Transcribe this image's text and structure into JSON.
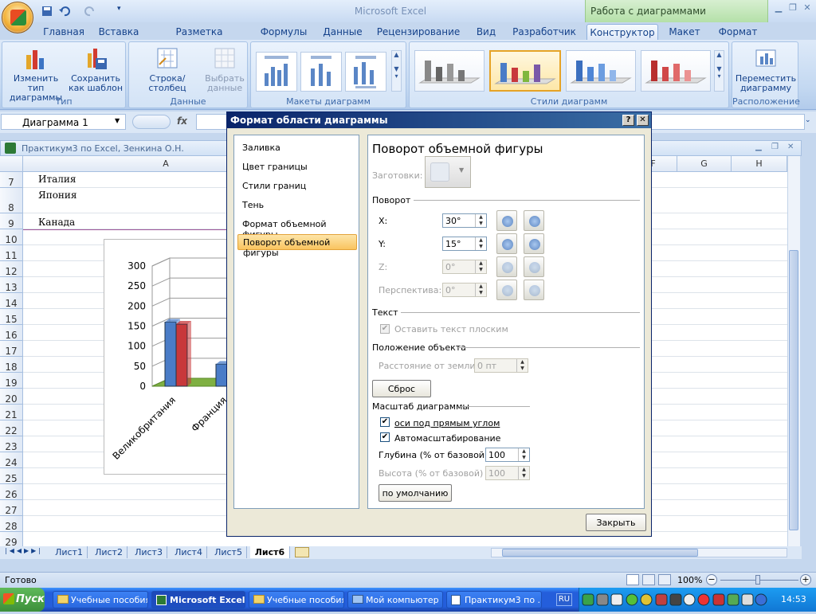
{
  "app": {
    "title": "Microsoft Excel",
    "context_tab_group": "Работа с диаграммами"
  },
  "ribbon": {
    "tabs": [
      "Главная",
      "Вставка",
      "Разметка страницы",
      "Формулы",
      "Данные",
      "Рецензирование",
      "Вид",
      "Разработчик",
      "Конструктор",
      "Макет",
      "Формат"
    ],
    "active_tab": "Конструктор",
    "groups": {
      "type": {
        "label": "Тип",
        "change_type": "Изменить тип диаграммы",
        "save_template": "Сохранить как шаблон"
      },
      "data": {
        "label": "Данные",
        "switch_row_col": "Строка/столбец",
        "select_data": "Выбрать данные"
      },
      "layouts": {
        "label": "Макеты диаграмм"
      },
      "styles": {
        "label": "Стили диаграмм"
      },
      "location": {
        "label": "Расположение",
        "move_chart": "Переместить диаграмму"
      }
    }
  },
  "formula_bar": {
    "name_box": "Диаграмма 1",
    "fx": "fx",
    "value": ""
  },
  "workbook": {
    "title": "Практикум3 по Excel, Зенкина О.Н.",
    "columns": [
      "A",
      "F",
      "G",
      "H"
    ],
    "rows": [
      "7",
      "8",
      "9",
      "10",
      "11",
      "12",
      "13",
      "14",
      "15",
      "16",
      "17",
      "18",
      "19",
      "20",
      "21",
      "22",
      "23",
      "24",
      "25",
      "26",
      "27",
      "28",
      "29"
    ],
    "cells": {
      "r7": "Италия",
      "r8": "Япония",
      "r9": "Канада"
    }
  },
  "chart_data": {
    "type": "bar",
    "categories": [
      "Великобритания",
      "Франция"
    ],
    "series": [
      {
        "values": [
          160,
          55
        ]
      },
      {
        "values": [
          155,
          50
        ]
      }
    ],
    "ylim": [
      0,
      300
    ],
    "yticks": [
      "300",
      "250",
      "200",
      "150",
      "100",
      "50",
      "0"
    ],
    "colors": [
      "#4a7cc7",
      "#c8383b"
    ]
  },
  "sheets": {
    "tabs": [
      "Лист1",
      "Лист2",
      "Лист3",
      "Лист4",
      "Лист5",
      "Лист6"
    ],
    "active": "Лист6"
  },
  "status": {
    "ready": "Готово",
    "zoom": "100%"
  },
  "dialog": {
    "title": "Формат области диаграммы",
    "help": "?",
    "close_x": "✕",
    "nav": [
      "Заливка",
      "Цвет границы",
      "Стили границ",
      "Тень",
      "Формат объемной фигуры",
      "Поворот объемной фигуры"
    ],
    "nav_selected": "Поворот объемной фигуры",
    "heading": "Поворот объемной фигуры",
    "presets_label": "Заготовки:",
    "rotation_section": "Поворот",
    "x_label": "X:",
    "x_value": "30°",
    "y_label": "Y:",
    "y_value": "15°",
    "z_label": "Z:",
    "z_value": "0°",
    "persp_label": "Перспектива:",
    "persp_value": "0°",
    "text_section": "Текст",
    "keep_flat": "Оставить текст плоским",
    "position_section": "Положение объекта",
    "distance_label": "Расстояние от земли:",
    "distance_value": "0 пт",
    "reset": "Сброс",
    "scale_section": "Масштаб диаграммы",
    "right_angle": "оси под прямым углом",
    "autoscale": "Автомасштабирование",
    "depth_label": "Глубина (% от базовой)",
    "depth_value": "100",
    "height_label": "Высота (% от базовой)",
    "height_value": "100",
    "default_btn": "по умолчанию",
    "close_btn": "Закрыть"
  },
  "taskbar": {
    "start": "Пуск",
    "items": [
      "Учебные пособия",
      "Microsoft Excel",
      "Учебные пособия",
      "Мой компьютер",
      "Практикум3 по ..."
    ],
    "active": "Microsoft Excel",
    "lang": "RU",
    "clock": "14:53"
  }
}
